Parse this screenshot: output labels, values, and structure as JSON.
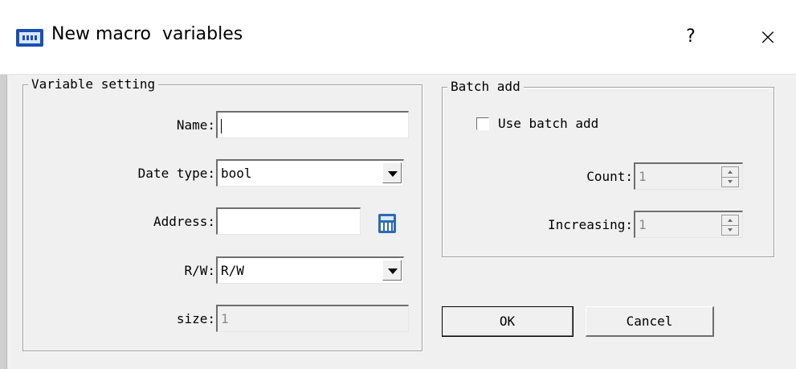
{
  "window": {
    "title": "New macro  variables",
    "help_label": "?",
    "close_label": "×"
  },
  "variable_setting": {
    "title": "Variable setting",
    "name_label": "Name:",
    "name_value": "",
    "datatype_label": "Date type:",
    "datatype_value": "bool",
    "address_label": "Address:",
    "address_value": "",
    "rw_label": "R/W:",
    "rw_value": "R/W",
    "size_label": "size:",
    "size_value": "1"
  },
  "batch_add": {
    "title": "Batch add",
    "use_batch_label": "Use batch add",
    "use_batch_checked": false,
    "count_label": "Count:",
    "count_value": "1",
    "increasing_label": "Increasing:",
    "increasing_value": "1"
  },
  "buttons": {
    "ok_label": "OK",
    "cancel_label": "Cancel"
  },
  "icons": {
    "app": "hmi-app-icon",
    "address_picker": "calculator-icon"
  }
}
